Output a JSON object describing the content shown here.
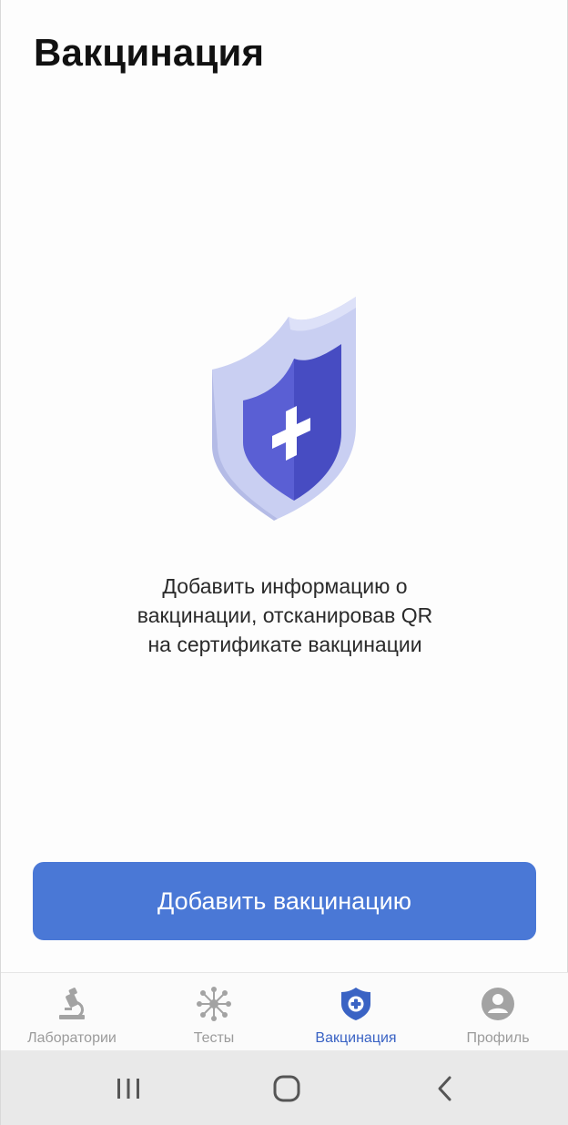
{
  "header": {
    "title": "Вакцинация"
  },
  "illustration": {
    "icon": "shield-plus-icon",
    "colors": {
      "shield_outer": "#c7cdf0",
      "shield_inner": "#4f55cc",
      "cross": "#ffffff"
    }
  },
  "main": {
    "description_lines": [
      "Добавить информацию о",
      "вакцинации, отсканировав QR",
      "на сертификате вакцинации"
    ],
    "add_button_label": "Добавить вакцинацию"
  },
  "bottom_nav": {
    "items": [
      {
        "label": "Лаборатории",
        "icon": "microscope-icon",
        "active": false
      },
      {
        "label": "Тесты",
        "icon": "virus-icon",
        "active": false
      },
      {
        "label": "Вакцинация",
        "icon": "shield-plus-icon",
        "active": true
      },
      {
        "label": "Профиль",
        "icon": "profile-icon",
        "active": false
      }
    ]
  },
  "system_nav": {
    "buttons": [
      "recent-apps-icon",
      "home-icon",
      "back-icon"
    ]
  },
  "colors": {
    "accent": "#4a78d6",
    "nav_active": "#3a63c4",
    "nav_inactive": "#9b9b9b"
  }
}
